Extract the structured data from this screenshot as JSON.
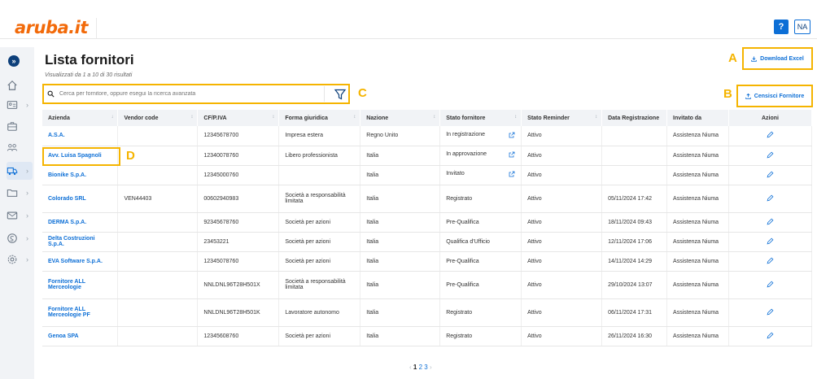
{
  "header": {
    "logo_text": "aruba.it",
    "help_label": "?",
    "user_initials": "NA"
  },
  "page": {
    "title": "Lista fornitori",
    "subtitle": "Visualizzati da 1 a 10 di 30 risultati"
  },
  "search": {
    "placeholder": "Cerca per fornitore, oppure esegui la ricerca avanzata",
    "value": ""
  },
  "buttons": {
    "download_excel": "Download Excel",
    "censisci_fornitore": "Censisci Fornitore"
  },
  "callouts": {
    "a": "A",
    "b": "B",
    "c": "C",
    "d": "D"
  },
  "table": {
    "columns": [
      "Azienda",
      "Vendor code",
      "CF/P.IVA",
      "Forma giuridica",
      "Nazione",
      "Stato fornitore",
      "Stato Reminder",
      "Data Registrazione",
      "Invitato da",
      "Azioni"
    ],
    "rows": [
      {
        "azienda": "A.S.A.",
        "vendor": "",
        "cf": "12345678700",
        "forma": "Impresa estera",
        "nazione": "Regno Unito",
        "stato": "In registrazione",
        "ext": true,
        "reminder": "Attivo",
        "data": "",
        "invitato": "Assistenza Niuma",
        "tall": false
      },
      {
        "azienda": "Avv. Luisa Spagnoli",
        "vendor": "",
        "cf": "12340078760",
        "forma": "Libero professionista",
        "nazione": "Italia",
        "stato": "In approvazione",
        "ext": true,
        "reminder": "Attivo",
        "data": "",
        "invitato": "Assistenza Niuma",
        "tall": false
      },
      {
        "azienda": "Bionike S.p.A.",
        "vendor": "",
        "cf": "12345000760",
        "forma": "",
        "nazione": "Italia",
        "stato": "Invitato",
        "ext": true,
        "reminder": "Attivo",
        "data": "",
        "invitato": "Assistenza Niuma",
        "tall": false
      },
      {
        "azienda": "Colorado SRL",
        "vendor": "VEN44403",
        "cf": "00602940983",
        "forma": "Società a responsabilità limitata",
        "nazione": "Italia",
        "stato": "Registrato",
        "ext": false,
        "reminder": "Attivo",
        "data": "05/11/2024 17:42",
        "invitato": "Assistenza Niuma",
        "tall": true
      },
      {
        "azienda": "DERMA S.p.A.",
        "vendor": "",
        "cf": "92345678760",
        "forma": "Società per azioni",
        "nazione": "Italia",
        "stato": "Pre-Qualifica",
        "ext": false,
        "reminder": "Attivo",
        "data": "18/11/2024 09:43",
        "invitato": "Assistenza Niuma",
        "tall": false
      },
      {
        "azienda": "Delta Costruzioni S.p.A.",
        "vendor": "",
        "cf": "23453221",
        "forma": "Società per azioni",
        "nazione": "Italia",
        "stato": "Qualifica d'Ufficio",
        "ext": false,
        "reminder": "Attivo",
        "data": "12/11/2024 17:06",
        "invitato": "Assistenza Niuma",
        "tall": false
      },
      {
        "azienda": "EVA Software S.p.A.",
        "vendor": "",
        "cf": "12345078760",
        "forma": "Società per azioni",
        "nazione": "Italia",
        "stato": "Pre-Qualifica",
        "ext": false,
        "reminder": "Attivo",
        "data": "14/11/2024 14:29",
        "invitato": "Assistenza Niuma",
        "tall": false
      },
      {
        "azienda": "Fornitore ALL Merceologie",
        "vendor": "",
        "cf": "NNLDNL96T28H501X",
        "forma": "Società a responsabilità limitata",
        "nazione": "Italia",
        "stato": "Pre-Qualifica",
        "ext": false,
        "reminder": "Attivo",
        "data": "29/10/2024 13:07",
        "invitato": "Assistenza Niuma",
        "tall": true
      },
      {
        "azienda": "Fornitore ALL Merceologie PF",
        "vendor": "",
        "cf": "NNLDNL96T28H501K",
        "forma": "Lavoratore autonomo",
        "nazione": "Italia",
        "stato": "Registrato",
        "ext": false,
        "reminder": "Attivo",
        "data": "06/11/2024 17:31",
        "invitato": "Assistenza Niuma",
        "tall": true
      },
      {
        "azienda": "Genoa SPA",
        "vendor": "",
        "cf": "12345608760",
        "forma": "Società per azioni",
        "nazione": "Italia",
        "stato": "Registrato",
        "ext": false,
        "reminder": "Attivo",
        "data": "26/11/2024 16:30",
        "invitato": "Assistenza Niuma",
        "tall": false
      }
    ]
  },
  "pagination": {
    "prev": "‹",
    "pages": [
      "1",
      "2",
      "3"
    ],
    "current": "1",
    "next": "›"
  },
  "colors": {
    "brand": "#f26a0a",
    "accent": "#0d6fd6",
    "highlight": "#f5b400"
  }
}
